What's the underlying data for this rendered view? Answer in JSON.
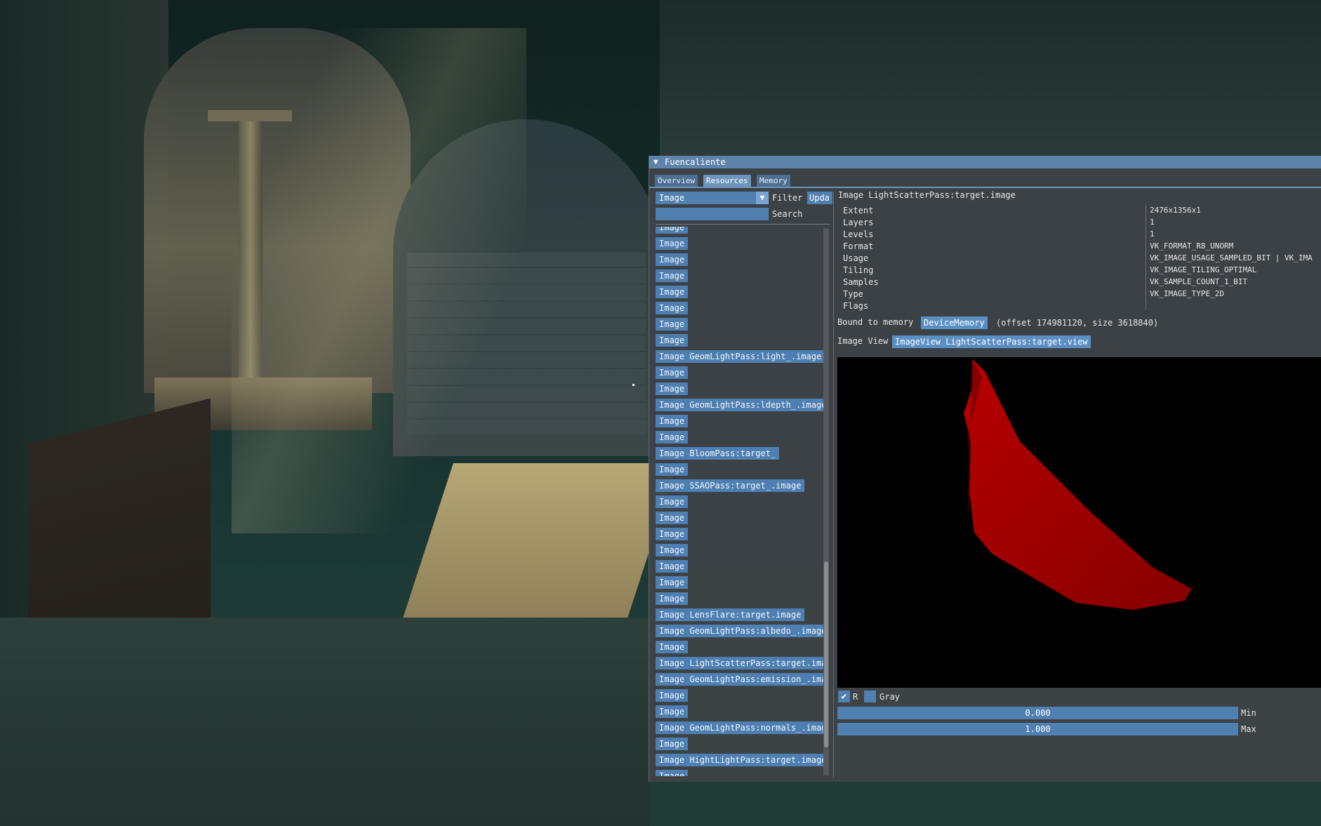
{
  "window": {
    "title": "Fuencaliente",
    "collapse_icon": "triangle-down-icon"
  },
  "tabs": [
    {
      "label": "Overview",
      "active": false
    },
    {
      "label": "Resources",
      "active": true
    },
    {
      "label": "Memory",
      "active": false
    }
  ],
  "filter": {
    "type_value": "Image",
    "filter_label": "Filter",
    "update_label": "Upda",
    "search_value": "",
    "search_label": "Search"
  },
  "resources": [
    "Image",
    "Image",
    "Image",
    "Image",
    "Image",
    "Image",
    "Image",
    "Image",
    "Image GeomLightPass:light_.image",
    "Image",
    "Image",
    "Image GeomLightPass:ldepth_.image",
    "Image",
    "Image",
    "Image BloomPass:target_",
    "Image",
    "Image SSAOPass:target_.image",
    "Image",
    "Image",
    "Image",
    "Image",
    "Image",
    "Image",
    "Image",
    "Image LensFlare:target.image",
    "Image GeomLightPass:albedo_.image",
    "Image",
    "Image LightScatterPass:target.ima",
    "Image GeomLightPass:emission_.ima",
    "Image",
    "Image",
    "Image GeomLightPass:normals_.imag",
    "Image",
    "Image HightLightPass:target.image",
    "Image"
  ],
  "details": {
    "heading": "Image LightScatterPass:target.image",
    "properties": [
      {
        "name": "Extent",
        "value": "2476x1356x1"
      },
      {
        "name": "Layers",
        "value": "1"
      },
      {
        "name": "Levels",
        "value": "1"
      },
      {
        "name": "Format",
        "value": "VK_FORMAT_R8_UNORM"
      },
      {
        "name": "Usage",
        "value": "VK_IMAGE_USAGE_SAMPLED_BIT | VK_IMA"
      },
      {
        "name": "Tiling",
        "value": "VK_IMAGE_TILING_OPTIMAL"
      },
      {
        "name": "Samples",
        "value": "VK_SAMPLE_COUNT_1_BIT"
      },
      {
        "name": "Type",
        "value": "VK_IMAGE_TYPE_2D"
      },
      {
        "name": "Flags",
        "value": ""
      }
    ],
    "bound_label": "Bound to memory",
    "memory_button": "DeviceMemory",
    "memory_info": "(offset 174981120, size 3618840)",
    "view_label": "Image View",
    "view_button": "ImageView LightScatterPass:target.view"
  },
  "preview_controls": {
    "r_label": "R",
    "r_checked": true,
    "gray_label": "Gray",
    "gray_checked": false,
    "min_value": "0.000",
    "min_label": "Min",
    "max_value": "1.000",
    "max_label": "Max"
  },
  "colors": {
    "title_bar": "#5d83ab",
    "button_blue": "#4d7fb2",
    "preview_red": "#b00000"
  }
}
